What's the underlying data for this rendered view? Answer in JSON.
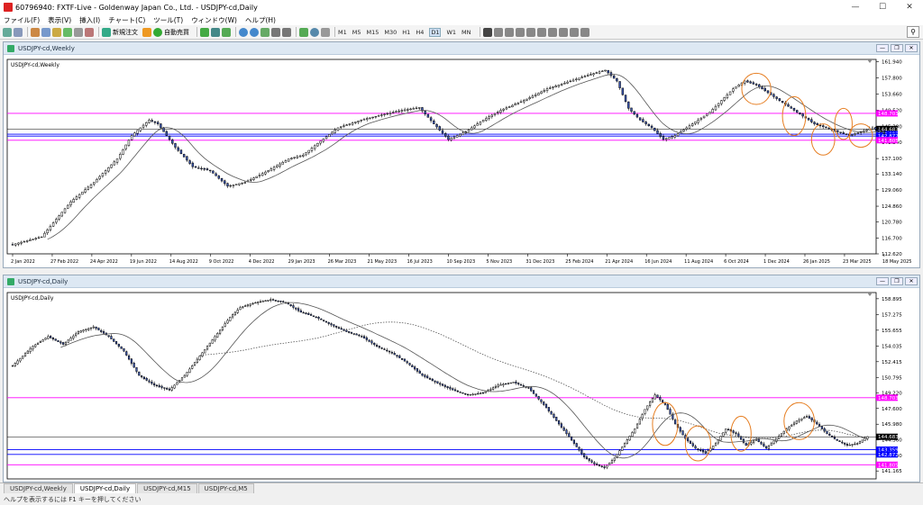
{
  "window_title": "60796940: FXTF-Live - Goldenway Japan Co., Ltd. - USDJPY-cd,Daily",
  "menu": [
    "ファイル(F)",
    "表示(V)",
    "挿入(I)",
    "チャート(C)",
    "ツール(T)",
    "ウィンドウ(W)",
    "ヘルプ(H)"
  ],
  "toolbar": {
    "new_order": "新規注文",
    "auto_trading": "自動売買"
  },
  "timeframes": [
    "M1",
    "M5",
    "M15",
    "M30",
    "H1",
    "H4",
    "D1",
    "W1",
    "MN"
  ],
  "active_timeframe": "D1",
  "status_text": "ヘルプを表示するには F1 キーを押してください",
  "tabs": [
    "USDJPY-cd,Weekly",
    "USDJPY-cd,Daily",
    "USDJPY-cd,M15",
    "USDJPY-cd,M5"
  ],
  "active_tab": "USDJPY-cd,Daily",
  "colors": {
    "bull": "#ffffff",
    "bear": "#3a56b0",
    "magenta": "#ff00ff",
    "blue": "#0000ff",
    "ma": "#555555",
    "orange": "#e67e22"
  },
  "chart_data": [
    {
      "type": "candlestick",
      "title": "USDJPY-cd,Weekly",
      "caption": "USDJPY-cd,Weekly",
      "ylim": [
        112.62,
        162.56
      ],
      "yticks": [
        161.94,
        157.8,
        153.66,
        149.52,
        145.38,
        141.24,
        137.1,
        133.14,
        129.06,
        124.86,
        120.78,
        116.7,
        112.62
      ],
      "xticks": [
        "2 Jan 2022",
        "27 Feb 2022",
        "24 Apr 2022",
        "19 Jun 2022",
        "14 Aug 2022",
        "9 Oct 2022",
        "4 Dec 2022",
        "29 Jan 2023",
        "26 Mar 2023",
        "21 May 2023",
        "16 Jul 2023",
        "10 Sep 2023",
        "5 Nov 2023",
        "31 Dec 2023",
        "25 Feb 2024",
        "21 Apr 2024",
        "16 Jun 2024",
        "11 Aug 2024",
        "6 Oct 2024",
        "1 Dec 2024",
        "26 Jan 2025",
        "23 Mar 2025",
        "18 May 2025"
      ],
      "anchors": [
        [
          0,
          115
        ],
        [
          10,
          117
        ],
        [
          20,
          126
        ],
        [
          28,
          131
        ],
        [
          36,
          137
        ],
        [
          41,
          143
        ],
        [
          47,
          147
        ],
        [
          50,
          146
        ],
        [
          56,
          140
        ],
        [
          62,
          135
        ],
        [
          68,
          134
        ],
        [
          74,
          130
        ],
        [
          80,
          131
        ],
        [
          88,
          134
        ],
        [
          95,
          137
        ],
        [
          100,
          138
        ],
        [
          105,
          141
        ],
        [
          112,
          145
        ],
        [
          120,
          147
        ],
        [
          128,
          148.5
        ],
        [
          134,
          149.5
        ],
        [
          140,
          150.2
        ],
        [
          145,
          146
        ],
        [
          150,
          142
        ],
        [
          156,
          144
        ],
        [
          162,
          147
        ],
        [
          168,
          149.5
        ],
        [
          176,
          152
        ],
        [
          184,
          155
        ],
        [
          192,
          157
        ],
        [
          198,
          158.5
        ],
        [
          204,
          159.8
        ],
        [
          208,
          157
        ],
        [
          212,
          150
        ],
        [
          216,
          147
        ],
        [
          220,
          145
        ],
        [
          224,
          142
        ],
        [
          228,
          143
        ],
        [
          232,
          145
        ],
        [
          236,
          147
        ],
        [
          240,
          149
        ],
        [
          244,
          152
        ],
        [
          248,
          155
        ],
        [
          252,
          157
        ],
        [
          256,
          156
        ],
        [
          260,
          154
        ],
        [
          264,
          152
        ],
        [
          268,
          150
        ],
        [
          272,
          148
        ],
        [
          276,
          146
        ],
        [
          280,
          145
        ],
        [
          284,
          144
        ],
        [
          288,
          143
        ],
        [
          292,
          144
        ],
        [
          296,
          145
        ],
        [
          300,
          143.5
        ]
      ],
      "ma_period": 13,
      "hlines": [
        {
          "price": 148.703,
          "label": "148.703",
          "color": "#ff00ff"
        },
        {
          "price": 144.683,
          "label": "144.683",
          "color": "#000000"
        },
        {
          "price": 143.359,
          "label": "143.359",
          "color": "#0000ff"
        },
        {
          "price": 142.872,
          "label": "142.872",
          "color": "#0000ff"
        },
        {
          "price": 141.805,
          "label": "141.805",
          "color": "#ff00ff"
        }
      ]
    },
    {
      "type": "candlestick",
      "title": "USDJPY-cd,Daily",
      "caption": "USDJPY-cd,Daily",
      "ylim": [
        140.35,
        159.53
      ],
      "yticks": [
        158.895,
        157.275,
        155.655,
        154.035,
        152.415,
        150.795,
        149.22,
        147.6,
        145.98,
        144.36,
        142.74,
        141.165
      ],
      "anchors": [
        [
          0,
          152
        ],
        [
          8,
          154
        ],
        [
          14,
          155
        ],
        [
          20,
          154.2
        ],
        [
          26,
          155.5
        ],
        [
          32,
          156
        ],
        [
          38,
          155
        ],
        [
          44,
          153.5
        ],
        [
          50,
          151
        ],
        [
          56,
          150
        ],
        [
          62,
          149.5
        ],
        [
          68,
          151
        ],
        [
          74,
          153
        ],
        [
          80,
          155
        ],
        [
          86,
          157
        ],
        [
          90,
          158
        ],
        [
          96,
          158.5
        ],
        [
          102,
          158.8
        ],
        [
          108,
          158.5
        ],
        [
          114,
          157.5
        ],
        [
          120,
          157
        ],
        [
          126,
          156.2
        ],
        [
          132,
          155.5
        ],
        [
          138,
          155
        ],
        [
          144,
          154
        ],
        [
          150,
          153.3
        ],
        [
          156,
          152.3
        ],
        [
          162,
          151
        ],
        [
          168,
          150.2
        ],
        [
          174,
          149.5
        ],
        [
          180,
          149
        ],
        [
          186,
          149.2
        ],
        [
          192,
          150
        ],
        [
          198,
          150.3
        ],
        [
          204,
          149.7
        ],
        [
          210,
          148
        ],
        [
          216,
          146
        ],
        [
          222,
          144
        ],
        [
          226,
          142.6
        ],
        [
          230,
          141.9
        ],
        [
          234,
          141.5
        ],
        [
          238,
          142.5
        ],
        [
          242,
          144
        ],
        [
          246,
          145.5
        ],
        [
          250,
          147.5
        ],
        [
          254,
          149
        ],
        [
          258,
          148
        ],
        [
          262,
          146
        ],
        [
          266,
          144.5
        ],
        [
          270,
          143.5
        ],
        [
          274,
          143
        ],
        [
          278,
          144
        ],
        [
          282,
          145.5
        ],
        [
          286,
          145
        ],
        [
          290,
          143.8
        ],
        [
          294,
          144.4
        ],
        [
          298,
          143.5
        ],
        [
          302,
          144.5
        ],
        [
          306,
          145.5
        ],
        [
          310,
          146.3
        ],
        [
          314,
          146.8
        ],
        [
          318,
          146
        ],
        [
          322,
          145
        ],
        [
          326,
          144.3
        ],
        [
          330,
          143.8
        ],
        [
          334,
          144
        ],
        [
          338,
          144.7
        ]
      ],
      "ma_fast": 20,
      "ma_slow": 75,
      "hlines": [
        {
          "price": 148.703,
          "label": "148.703",
          "color": "#ff00ff"
        },
        {
          "price": 144.683,
          "label": "144.683",
          "color": "#000000"
        },
        {
          "price": 143.359,
          "label": "143.359",
          "color": "#0000ff"
        },
        {
          "price": 142.872,
          "label": "142.872",
          "color": "#0000ff"
        },
        {
          "price": 141.805,
          "label": "141.805",
          "color": "#ff00ff"
        }
      ]
    }
  ]
}
